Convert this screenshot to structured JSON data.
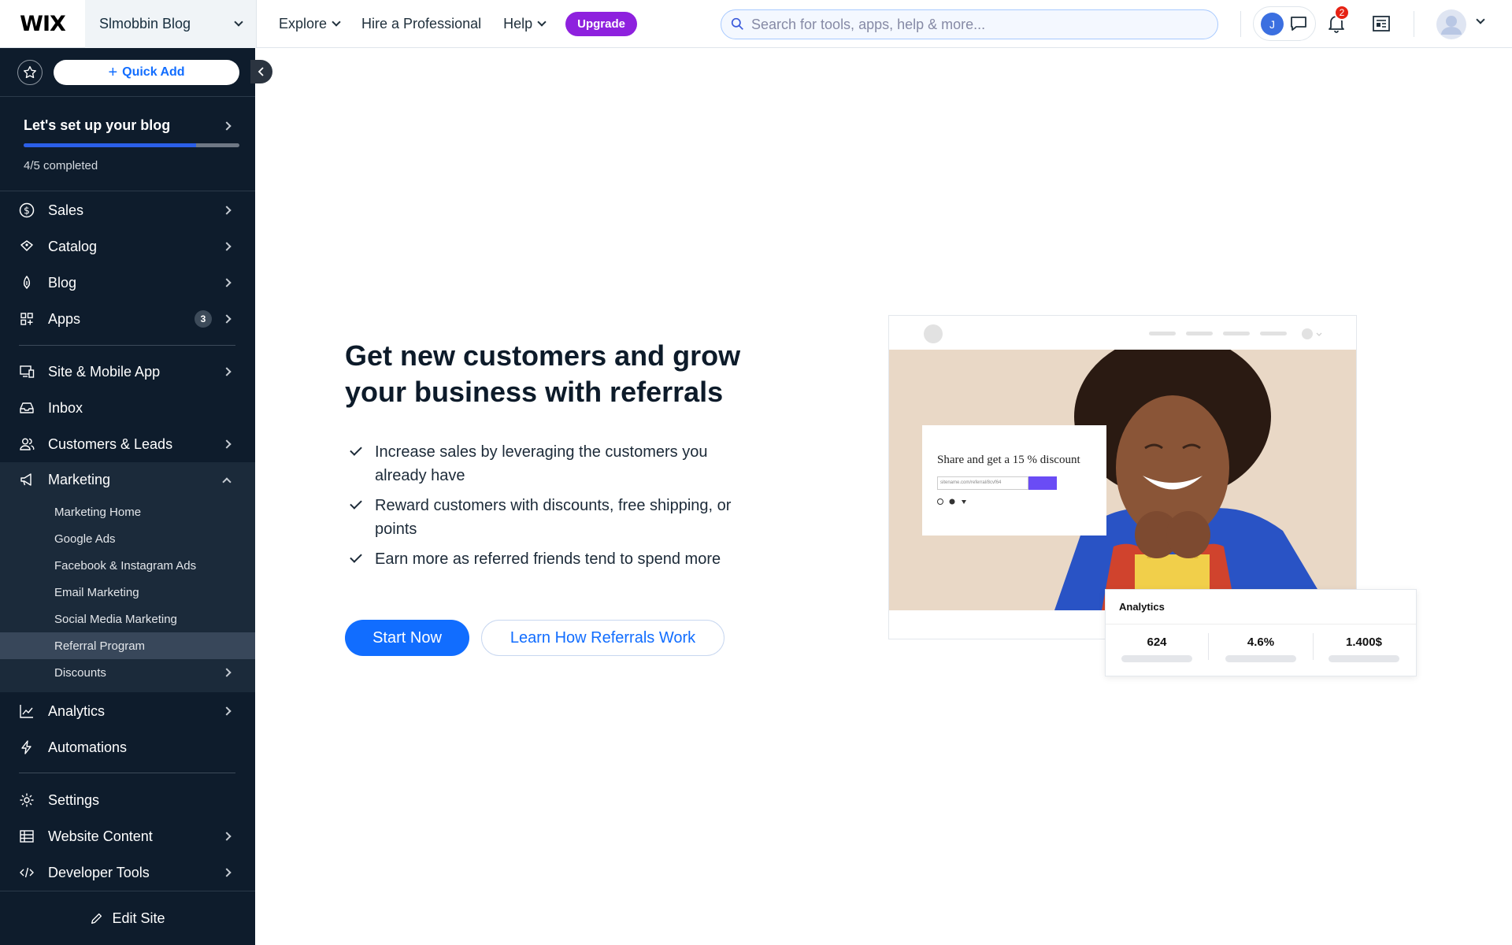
{
  "topbar": {
    "logo": "WIX",
    "site_name": "Slmobbin Blog",
    "nav": {
      "explore": "Explore",
      "hire": "Hire a Professional",
      "help": "Help",
      "upgrade": "Upgrade"
    },
    "search_placeholder": "Search for tools, apps, help & more...",
    "avatar_initial": "J",
    "notification_count": "2"
  },
  "sidebar": {
    "quick_add": "Quick Add",
    "setup_title": "Let's set up your blog",
    "setup_progress_text": "4/5 completed",
    "setup_progress_fraction": 0.8,
    "items": {
      "sales": "Sales",
      "catalog": "Catalog",
      "blog": "Blog",
      "apps": "Apps",
      "apps_count": "3",
      "site_mobile": "Site & Mobile App",
      "inbox": "Inbox",
      "customers": "Customers & Leads",
      "marketing": "Marketing",
      "analytics": "Analytics",
      "automations": "Automations",
      "settings": "Settings",
      "website_content": "Website Content",
      "developer_tools": "Developer Tools"
    },
    "marketing_sub": [
      "Marketing Home",
      "Google Ads",
      "Facebook & Instagram Ads",
      "Email Marketing",
      "Social Media Marketing",
      "Referral Program",
      "Discounts"
    ],
    "edit_site": "Edit Site"
  },
  "main": {
    "title_line1": "Get new customers and grow",
    "title_line2": "your business with referrals",
    "bullets": [
      "Increase sales by leveraging the customers you already have",
      "Reward customers with discounts, free shipping, or points",
      "Earn more as referred friends tend to spend more"
    ],
    "start_now": "Start Now",
    "learn_how": "Learn How Referrals Work"
  },
  "illustration": {
    "share_title": "Share and get a 15 % discount",
    "share_link": "sitename.com/referral/8cvf64",
    "analytics_title": "Analytics",
    "analytics_values": [
      "624",
      "4.6%",
      "1.400$"
    ]
  },
  "colors": {
    "sidebar_bg": "#0e1c2c",
    "accent_blue": "#116dff",
    "upgrade_purple": "#8e21de",
    "badge_red": "#e62214"
  }
}
